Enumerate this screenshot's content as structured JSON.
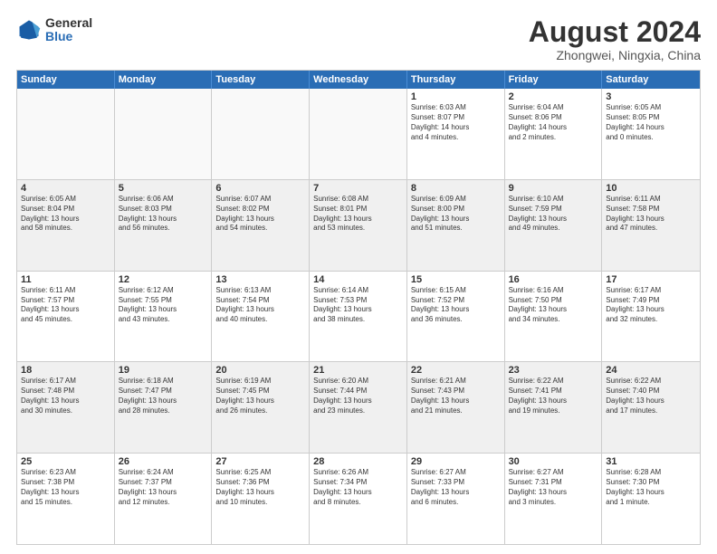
{
  "logo": {
    "general": "General",
    "blue": "Blue"
  },
  "title": "August 2024",
  "subtitle": "Zhongwei, Ningxia, China",
  "days": [
    "Sunday",
    "Monday",
    "Tuesday",
    "Wednesday",
    "Thursday",
    "Friday",
    "Saturday"
  ],
  "weeks": [
    [
      {
        "day": "",
        "info": ""
      },
      {
        "day": "",
        "info": ""
      },
      {
        "day": "",
        "info": ""
      },
      {
        "day": "",
        "info": ""
      },
      {
        "day": "1",
        "info": "Sunrise: 6:03 AM\nSunset: 8:07 PM\nDaylight: 14 hours\nand 4 minutes."
      },
      {
        "day": "2",
        "info": "Sunrise: 6:04 AM\nSunset: 8:06 PM\nDaylight: 14 hours\nand 2 minutes."
      },
      {
        "day": "3",
        "info": "Sunrise: 6:05 AM\nSunset: 8:05 PM\nDaylight: 14 hours\nand 0 minutes."
      }
    ],
    [
      {
        "day": "4",
        "info": "Sunrise: 6:05 AM\nSunset: 8:04 PM\nDaylight: 13 hours\nand 58 minutes."
      },
      {
        "day": "5",
        "info": "Sunrise: 6:06 AM\nSunset: 8:03 PM\nDaylight: 13 hours\nand 56 minutes."
      },
      {
        "day": "6",
        "info": "Sunrise: 6:07 AM\nSunset: 8:02 PM\nDaylight: 13 hours\nand 54 minutes."
      },
      {
        "day": "7",
        "info": "Sunrise: 6:08 AM\nSunset: 8:01 PM\nDaylight: 13 hours\nand 53 minutes."
      },
      {
        "day": "8",
        "info": "Sunrise: 6:09 AM\nSunset: 8:00 PM\nDaylight: 13 hours\nand 51 minutes."
      },
      {
        "day": "9",
        "info": "Sunrise: 6:10 AM\nSunset: 7:59 PM\nDaylight: 13 hours\nand 49 minutes."
      },
      {
        "day": "10",
        "info": "Sunrise: 6:11 AM\nSunset: 7:58 PM\nDaylight: 13 hours\nand 47 minutes."
      }
    ],
    [
      {
        "day": "11",
        "info": "Sunrise: 6:11 AM\nSunset: 7:57 PM\nDaylight: 13 hours\nand 45 minutes."
      },
      {
        "day": "12",
        "info": "Sunrise: 6:12 AM\nSunset: 7:55 PM\nDaylight: 13 hours\nand 43 minutes."
      },
      {
        "day": "13",
        "info": "Sunrise: 6:13 AM\nSunset: 7:54 PM\nDaylight: 13 hours\nand 40 minutes."
      },
      {
        "day": "14",
        "info": "Sunrise: 6:14 AM\nSunset: 7:53 PM\nDaylight: 13 hours\nand 38 minutes."
      },
      {
        "day": "15",
        "info": "Sunrise: 6:15 AM\nSunset: 7:52 PM\nDaylight: 13 hours\nand 36 minutes."
      },
      {
        "day": "16",
        "info": "Sunrise: 6:16 AM\nSunset: 7:50 PM\nDaylight: 13 hours\nand 34 minutes."
      },
      {
        "day": "17",
        "info": "Sunrise: 6:17 AM\nSunset: 7:49 PM\nDaylight: 13 hours\nand 32 minutes."
      }
    ],
    [
      {
        "day": "18",
        "info": "Sunrise: 6:17 AM\nSunset: 7:48 PM\nDaylight: 13 hours\nand 30 minutes."
      },
      {
        "day": "19",
        "info": "Sunrise: 6:18 AM\nSunset: 7:47 PM\nDaylight: 13 hours\nand 28 minutes."
      },
      {
        "day": "20",
        "info": "Sunrise: 6:19 AM\nSunset: 7:45 PM\nDaylight: 13 hours\nand 26 minutes."
      },
      {
        "day": "21",
        "info": "Sunrise: 6:20 AM\nSunset: 7:44 PM\nDaylight: 13 hours\nand 23 minutes."
      },
      {
        "day": "22",
        "info": "Sunrise: 6:21 AM\nSunset: 7:43 PM\nDaylight: 13 hours\nand 21 minutes."
      },
      {
        "day": "23",
        "info": "Sunrise: 6:22 AM\nSunset: 7:41 PM\nDaylight: 13 hours\nand 19 minutes."
      },
      {
        "day": "24",
        "info": "Sunrise: 6:22 AM\nSunset: 7:40 PM\nDaylight: 13 hours\nand 17 minutes."
      }
    ],
    [
      {
        "day": "25",
        "info": "Sunrise: 6:23 AM\nSunset: 7:38 PM\nDaylight: 13 hours\nand 15 minutes."
      },
      {
        "day": "26",
        "info": "Sunrise: 6:24 AM\nSunset: 7:37 PM\nDaylight: 13 hours\nand 12 minutes."
      },
      {
        "day": "27",
        "info": "Sunrise: 6:25 AM\nSunset: 7:36 PM\nDaylight: 13 hours\nand 10 minutes."
      },
      {
        "day": "28",
        "info": "Sunrise: 6:26 AM\nSunset: 7:34 PM\nDaylight: 13 hours\nand 8 minutes."
      },
      {
        "day": "29",
        "info": "Sunrise: 6:27 AM\nSunset: 7:33 PM\nDaylight: 13 hours\nand 6 minutes."
      },
      {
        "day": "30",
        "info": "Sunrise: 6:27 AM\nSunset: 7:31 PM\nDaylight: 13 hours\nand 3 minutes."
      },
      {
        "day": "31",
        "info": "Sunrise: 6:28 AM\nSunset: 7:30 PM\nDaylight: 13 hours\nand 1 minute."
      }
    ]
  ]
}
